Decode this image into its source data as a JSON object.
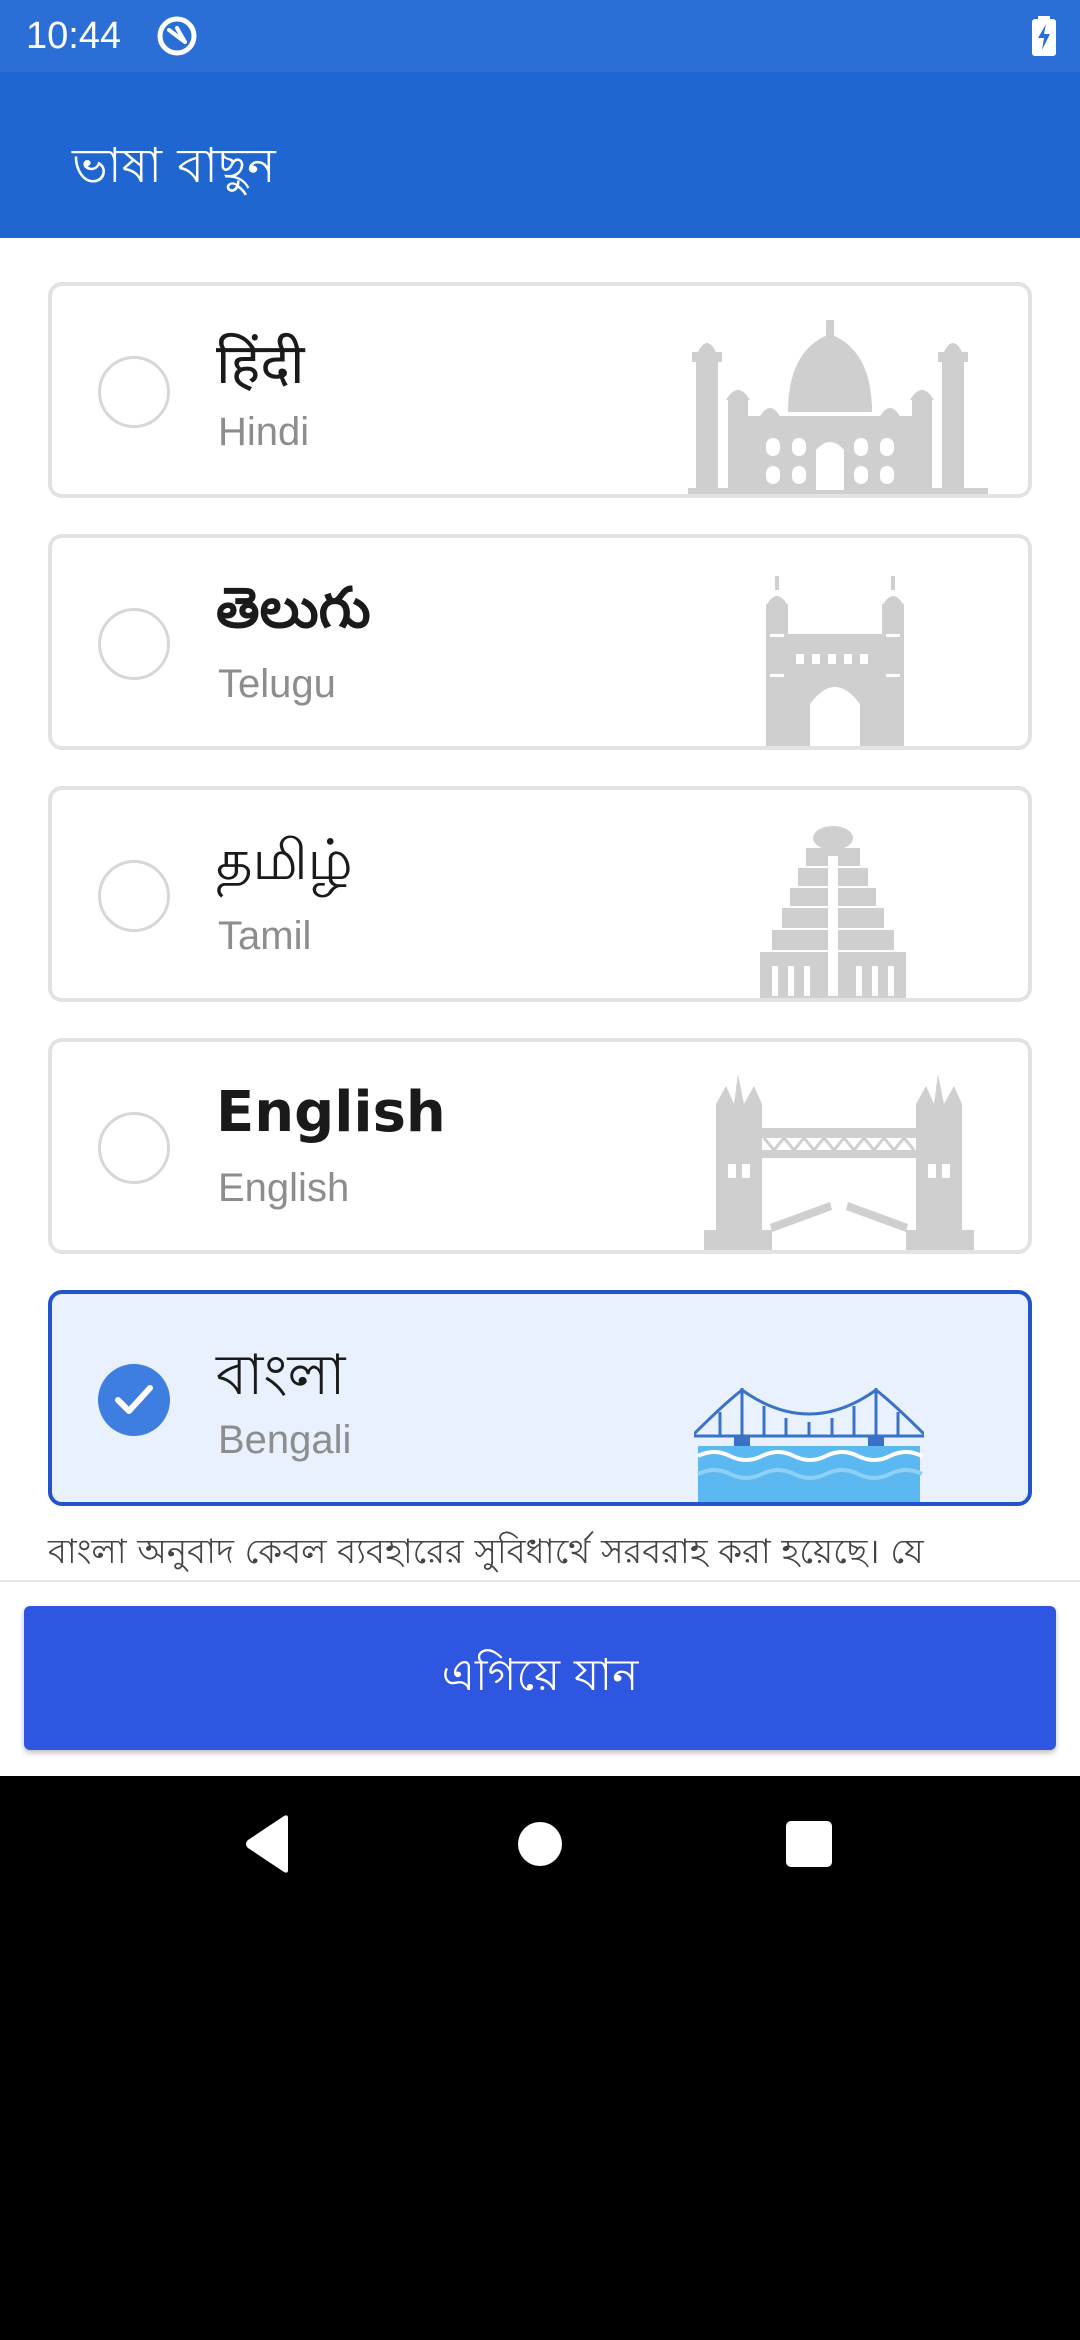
{
  "status_bar": {
    "time": "10:44",
    "icons": [
      "app-notification-icon",
      "battery-charging-icon"
    ]
  },
  "app_bar": {
    "title": "ভাষা বাছুন"
  },
  "languages": [
    {
      "native": "हिंदी",
      "english": "Hindi",
      "selected": false,
      "landmark": "taj-mahal-icon"
    },
    {
      "native": "తెలుగు",
      "english": "Telugu",
      "selected": false,
      "landmark": "charminar-icon"
    },
    {
      "native": "தமிழ்",
      "english": "Tamil",
      "selected": false,
      "landmark": "temple-gopuram-icon"
    },
    {
      "native": "English",
      "english": "English",
      "selected": false,
      "landmark": "tower-bridge-icon"
    },
    {
      "native": "বাংলা",
      "english": "Bengali",
      "selected": true,
      "landmark": "howrah-bridge-icon"
    }
  ],
  "disclaimer": "বাংলা অনুবাদ কেবল ব্যবহারের সুবিধার্থে সরবরাহ করা হয়েছে। যে",
  "continue_button": {
    "label": "এগিয়ে যান"
  },
  "nav_bar": {
    "icons": [
      "back-icon",
      "home-icon",
      "recents-icon"
    ]
  },
  "colors": {
    "status_bar": "#2b6fd6",
    "app_bar": "#1f66d0",
    "selected_border": "#2255cc",
    "selected_bg": "#e8f1fd",
    "button": "#2f56e0",
    "radio_checked": "#3d7ee0"
  }
}
